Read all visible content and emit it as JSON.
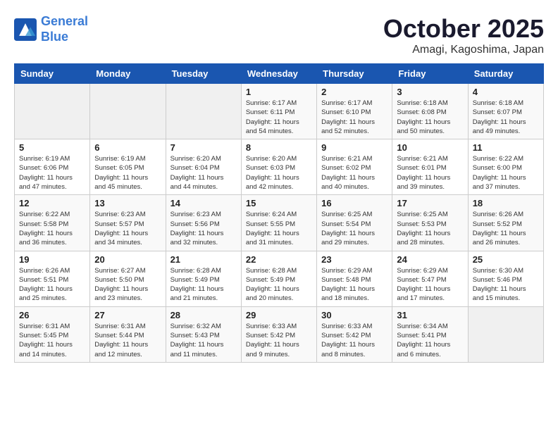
{
  "header": {
    "logo_line1": "General",
    "logo_line2": "Blue",
    "month": "October 2025",
    "location": "Amagi, Kagoshima, Japan"
  },
  "weekdays": [
    "Sunday",
    "Monday",
    "Tuesday",
    "Wednesday",
    "Thursday",
    "Friday",
    "Saturday"
  ],
  "rows": [
    [
      {
        "day": "",
        "info": ""
      },
      {
        "day": "",
        "info": ""
      },
      {
        "day": "",
        "info": ""
      },
      {
        "day": "1",
        "info": "Sunrise: 6:17 AM\nSunset: 6:11 PM\nDaylight: 11 hours\nand 54 minutes."
      },
      {
        "day": "2",
        "info": "Sunrise: 6:17 AM\nSunset: 6:10 PM\nDaylight: 11 hours\nand 52 minutes."
      },
      {
        "day": "3",
        "info": "Sunrise: 6:18 AM\nSunset: 6:08 PM\nDaylight: 11 hours\nand 50 minutes."
      },
      {
        "day": "4",
        "info": "Sunrise: 6:18 AM\nSunset: 6:07 PM\nDaylight: 11 hours\nand 49 minutes."
      }
    ],
    [
      {
        "day": "5",
        "info": "Sunrise: 6:19 AM\nSunset: 6:06 PM\nDaylight: 11 hours\nand 47 minutes."
      },
      {
        "day": "6",
        "info": "Sunrise: 6:19 AM\nSunset: 6:05 PM\nDaylight: 11 hours\nand 45 minutes."
      },
      {
        "day": "7",
        "info": "Sunrise: 6:20 AM\nSunset: 6:04 PM\nDaylight: 11 hours\nand 44 minutes."
      },
      {
        "day": "8",
        "info": "Sunrise: 6:20 AM\nSunset: 6:03 PM\nDaylight: 11 hours\nand 42 minutes."
      },
      {
        "day": "9",
        "info": "Sunrise: 6:21 AM\nSunset: 6:02 PM\nDaylight: 11 hours\nand 40 minutes."
      },
      {
        "day": "10",
        "info": "Sunrise: 6:21 AM\nSunset: 6:01 PM\nDaylight: 11 hours\nand 39 minutes."
      },
      {
        "day": "11",
        "info": "Sunrise: 6:22 AM\nSunset: 6:00 PM\nDaylight: 11 hours\nand 37 minutes."
      }
    ],
    [
      {
        "day": "12",
        "info": "Sunrise: 6:22 AM\nSunset: 5:58 PM\nDaylight: 11 hours\nand 36 minutes."
      },
      {
        "day": "13",
        "info": "Sunrise: 6:23 AM\nSunset: 5:57 PM\nDaylight: 11 hours\nand 34 minutes."
      },
      {
        "day": "14",
        "info": "Sunrise: 6:23 AM\nSunset: 5:56 PM\nDaylight: 11 hours\nand 32 minutes."
      },
      {
        "day": "15",
        "info": "Sunrise: 6:24 AM\nSunset: 5:55 PM\nDaylight: 11 hours\nand 31 minutes."
      },
      {
        "day": "16",
        "info": "Sunrise: 6:25 AM\nSunset: 5:54 PM\nDaylight: 11 hours\nand 29 minutes."
      },
      {
        "day": "17",
        "info": "Sunrise: 6:25 AM\nSunset: 5:53 PM\nDaylight: 11 hours\nand 28 minutes."
      },
      {
        "day": "18",
        "info": "Sunrise: 6:26 AM\nSunset: 5:52 PM\nDaylight: 11 hours\nand 26 minutes."
      }
    ],
    [
      {
        "day": "19",
        "info": "Sunrise: 6:26 AM\nSunset: 5:51 PM\nDaylight: 11 hours\nand 25 minutes."
      },
      {
        "day": "20",
        "info": "Sunrise: 6:27 AM\nSunset: 5:50 PM\nDaylight: 11 hours\nand 23 minutes."
      },
      {
        "day": "21",
        "info": "Sunrise: 6:28 AM\nSunset: 5:49 PM\nDaylight: 11 hours\nand 21 minutes."
      },
      {
        "day": "22",
        "info": "Sunrise: 6:28 AM\nSunset: 5:49 PM\nDaylight: 11 hours\nand 20 minutes."
      },
      {
        "day": "23",
        "info": "Sunrise: 6:29 AM\nSunset: 5:48 PM\nDaylight: 11 hours\nand 18 minutes."
      },
      {
        "day": "24",
        "info": "Sunrise: 6:29 AM\nSunset: 5:47 PM\nDaylight: 11 hours\nand 17 minutes."
      },
      {
        "day": "25",
        "info": "Sunrise: 6:30 AM\nSunset: 5:46 PM\nDaylight: 11 hours\nand 15 minutes."
      }
    ],
    [
      {
        "day": "26",
        "info": "Sunrise: 6:31 AM\nSunset: 5:45 PM\nDaylight: 11 hours\nand 14 minutes."
      },
      {
        "day": "27",
        "info": "Sunrise: 6:31 AM\nSunset: 5:44 PM\nDaylight: 11 hours\nand 12 minutes."
      },
      {
        "day": "28",
        "info": "Sunrise: 6:32 AM\nSunset: 5:43 PM\nDaylight: 11 hours\nand 11 minutes."
      },
      {
        "day": "29",
        "info": "Sunrise: 6:33 AM\nSunset: 5:42 PM\nDaylight: 11 hours\nand 9 minutes."
      },
      {
        "day": "30",
        "info": "Sunrise: 6:33 AM\nSunset: 5:42 PM\nDaylight: 11 hours\nand 8 minutes."
      },
      {
        "day": "31",
        "info": "Sunrise: 6:34 AM\nSunset: 5:41 PM\nDaylight: 11 hours\nand 6 minutes."
      },
      {
        "day": "",
        "info": ""
      }
    ]
  ]
}
